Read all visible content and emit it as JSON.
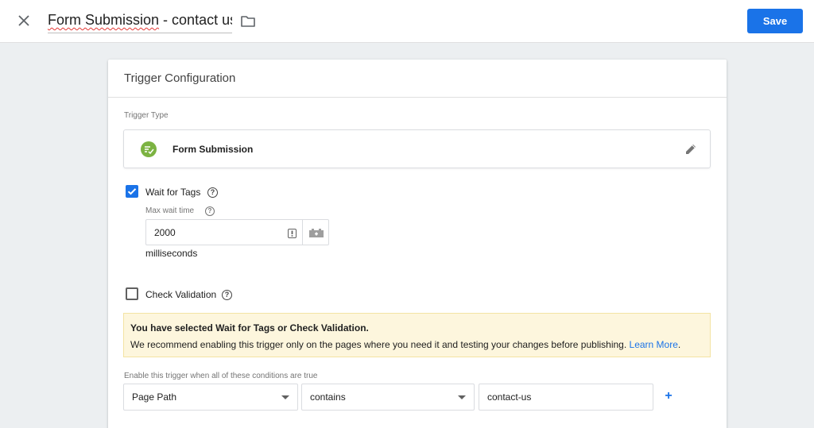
{
  "topbar": {
    "title_part1": "Form Submission",
    "title_part2": " - contact us",
    "save_label": "Save"
  },
  "card": {
    "title": "Trigger Configuration",
    "trigger_type_label": "Trigger Type",
    "trigger_type_name": "Form Submission",
    "trigger_type_icon": "form-submission-icon",
    "trigger_type_icon_color": "#7cb342"
  },
  "wait_for_tags": {
    "label": "Wait for Tags",
    "checked": true,
    "max_wait_label": "Max wait time",
    "max_wait_value": "2000",
    "unit": "milliseconds"
  },
  "check_validation": {
    "label": "Check Validation",
    "checked": false
  },
  "warning": {
    "title": "You have selected Wait for Tags or Check Validation.",
    "text": "We recommend enabling this trigger only on the pages where you need it and testing your changes before publishing.",
    "link": "Learn More",
    "link_suffix": "."
  },
  "conditions": {
    "label": "Enable this trigger when all of these conditions are true",
    "rows": [
      {
        "variable": "Page Path",
        "operator": "contains",
        "value": "contact-us"
      }
    ]
  },
  "colors": {
    "accent": "#1a73e8",
    "warning_bg": "#fdf6dd"
  }
}
